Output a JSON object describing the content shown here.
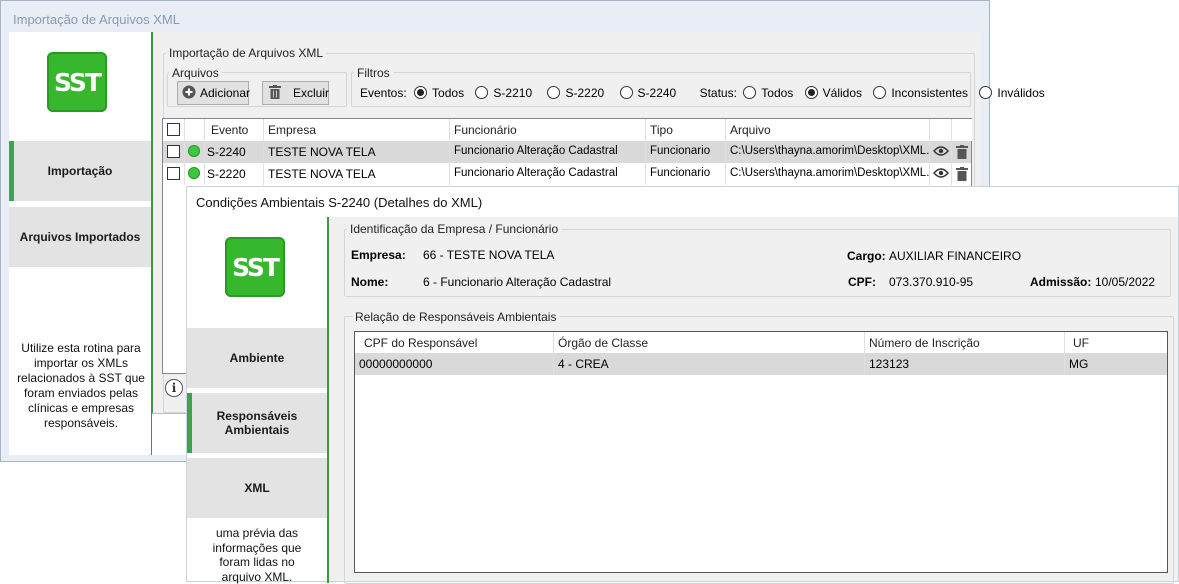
{
  "main_window": {
    "title": "Importação de Arquivos XML",
    "logo_text": "SST",
    "nav": [
      {
        "label": "Importação",
        "active": true
      },
      {
        "label": "Arquivos Importados",
        "active": false
      }
    ],
    "help_text": "Utilize esta rotina para importar os XMLs relacionados à SST que foram enviados pelas clínicas e empresas responsáveis.",
    "group_title": "Importação de Arquivos XML",
    "arquivos": {
      "title": "Arquivos",
      "add_label": "Adicionar",
      "delete_label": "Excluir"
    },
    "filtros": {
      "title": "Filtros",
      "eventos_label": "Eventos:",
      "eventos": [
        {
          "label": "Todos",
          "selected": true
        },
        {
          "label": "S-2210",
          "selected": false
        },
        {
          "label": "S-2220",
          "selected": false
        },
        {
          "label": "S-2240",
          "selected": false
        }
      ],
      "status_label": "Status:",
      "status": [
        {
          "label": "Todos",
          "selected": false
        },
        {
          "label": "Válidos",
          "selected": true
        },
        {
          "label": "Inconsistentes",
          "selected": false
        },
        {
          "label": "Inválidos",
          "selected": false
        }
      ]
    },
    "table": {
      "columns": [
        "Evento",
        "Empresa",
        "Funcionário",
        "Tipo",
        "Arquivo"
      ],
      "rows": [
        {
          "evento": "S-2240",
          "empresa": "TESTE NOVA TELA",
          "funcionario": "Funcionario Alteração Cadastral",
          "tipo": "Funcionario",
          "arquivo": "C:\\Users\\thayna.amorim\\Desktop\\XML...",
          "status_color": "#3ec63e",
          "selected": true
        },
        {
          "evento": "S-2220",
          "empresa": "TESTE NOVA TELA",
          "funcionario": "Funcionario Alteração Cadastral",
          "tipo": "Funcionario",
          "arquivo": "C:\\Users\\thayna.amorim\\Desktop\\XML...",
          "status_color": "#3ec63e",
          "selected": false
        }
      ]
    }
  },
  "detail_window": {
    "title": "Condições Ambientais S-2240 (Detalhes do XML)",
    "logo_text": "SST",
    "nav": [
      {
        "label": "Ambiente",
        "active": false
      },
      {
        "label": "Responsáveis Ambientais",
        "active": true
      },
      {
        "label": "XML",
        "active": false
      }
    ],
    "help_text": "uma prévia das informações que foram lidas no arquivo XML.",
    "identificacao": {
      "title": "Identificação da Empresa / Funcionário",
      "empresa_label": "Empresa:",
      "empresa_value": "66 - TESTE NOVA TELA",
      "cargo_label": "Cargo:",
      "cargo_value": "AUXILIAR FINANCEIRO",
      "nome_label": "Nome:",
      "nome_value": "6 - Funcionario Alteração Cadastral",
      "cpf_label": "CPF:",
      "cpf_value": "073.370.910-95",
      "admissao_label": "Admissão:",
      "admissao_value": "10/05/2022"
    },
    "responsaveis": {
      "title": "Relação de Responsáveis Ambientais",
      "columns": [
        "CPF do Responsável",
        "Órgão de Classe",
        "Número de Inscrição",
        "UF"
      ],
      "rows": [
        {
          "cpf": "00000000000",
          "orgao": "4 - CREA",
          "numero": "123123",
          "uf": "MG"
        }
      ]
    }
  },
  "colors": {
    "accent_green": "#3aa64a",
    "logo_green": "#36b72e",
    "row_selected": "#d9d9d9"
  }
}
